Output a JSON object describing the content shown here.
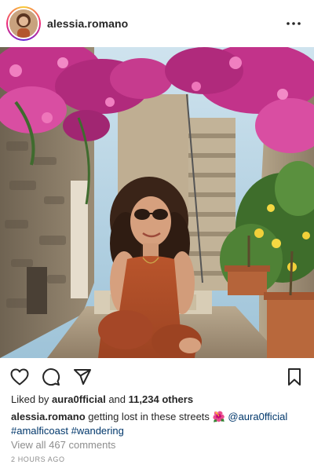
{
  "post": {
    "username": "alessia.romano",
    "more_icon": "more-horizontal-icon",
    "photo_alt": "Woman in rust dress crouching in a narrow stone alley with bougainvillea, sea view through arch"
  },
  "actions": {
    "like_icon": "heart-icon",
    "comment_icon": "comment-icon",
    "share_icon": "send-icon",
    "save_icon": "bookmark-icon"
  },
  "likes": {
    "prefix": "Liked by",
    "user": "aura0fficial",
    "joiner": "and",
    "others": "11,234 others"
  },
  "caption": {
    "username": "alessia.romano",
    "text": "getting lost in these streets",
    "emoji": "🌺",
    "mention": "@aura0fficial",
    "hashtag1": "#amalficoast",
    "hashtag2": "#wandering"
  },
  "comments_link": "View all 467 comments",
  "timestamp": "2 HOURS AGO",
  "colors": {
    "link": "#00376b",
    "muted": "#8e8e8e",
    "text": "#262626"
  }
}
